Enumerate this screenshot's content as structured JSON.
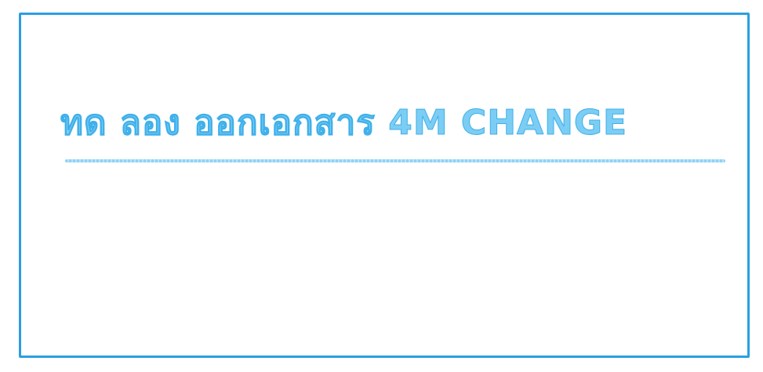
{
  "heading": {
    "text": "ทด ลอง ออกเอกสาร 4M  CHANGE",
    "color": "#7ccdf4",
    "border_color": "#2a9fe0"
  }
}
